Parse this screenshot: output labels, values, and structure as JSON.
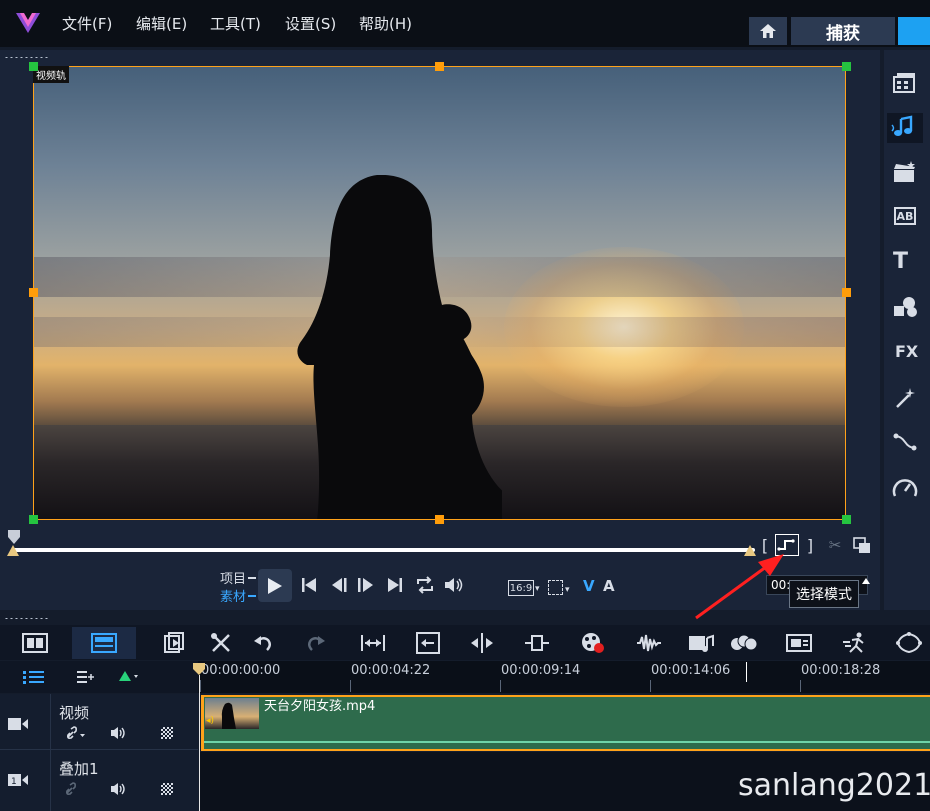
{
  "menu": {
    "file": "文件(F)",
    "edit": "编辑(E)",
    "tools": "工具(T)",
    "settings": "设置(S)",
    "help": "帮助(H)"
  },
  "tabs": {
    "capture": "捕获"
  },
  "preview": {
    "track_badge": "视频轨",
    "mode_project": "项目",
    "mode_clip": "素材",
    "aspect": "16:9",
    "timecode": "00:",
    "tooltip": "选择模式"
  },
  "side_panel": {
    "ab_label": "AB",
    "fx_label": "FX"
  },
  "timeline": {
    "ruler": [
      "00:00:00:00",
      "00:00:04:22",
      "00:00:09:14",
      "00:00:14:06",
      "00:00:18:28"
    ],
    "tracks": [
      {
        "name": "视频"
      },
      {
        "name": "叠加1"
      }
    ],
    "clip_name": "天台夕阳女孩.mp4"
  },
  "watermark": "sanlang2021",
  "colors": {
    "accent": "#1da1f2",
    "selection": "#ffa21a",
    "clip": "#2e6b4c"
  }
}
